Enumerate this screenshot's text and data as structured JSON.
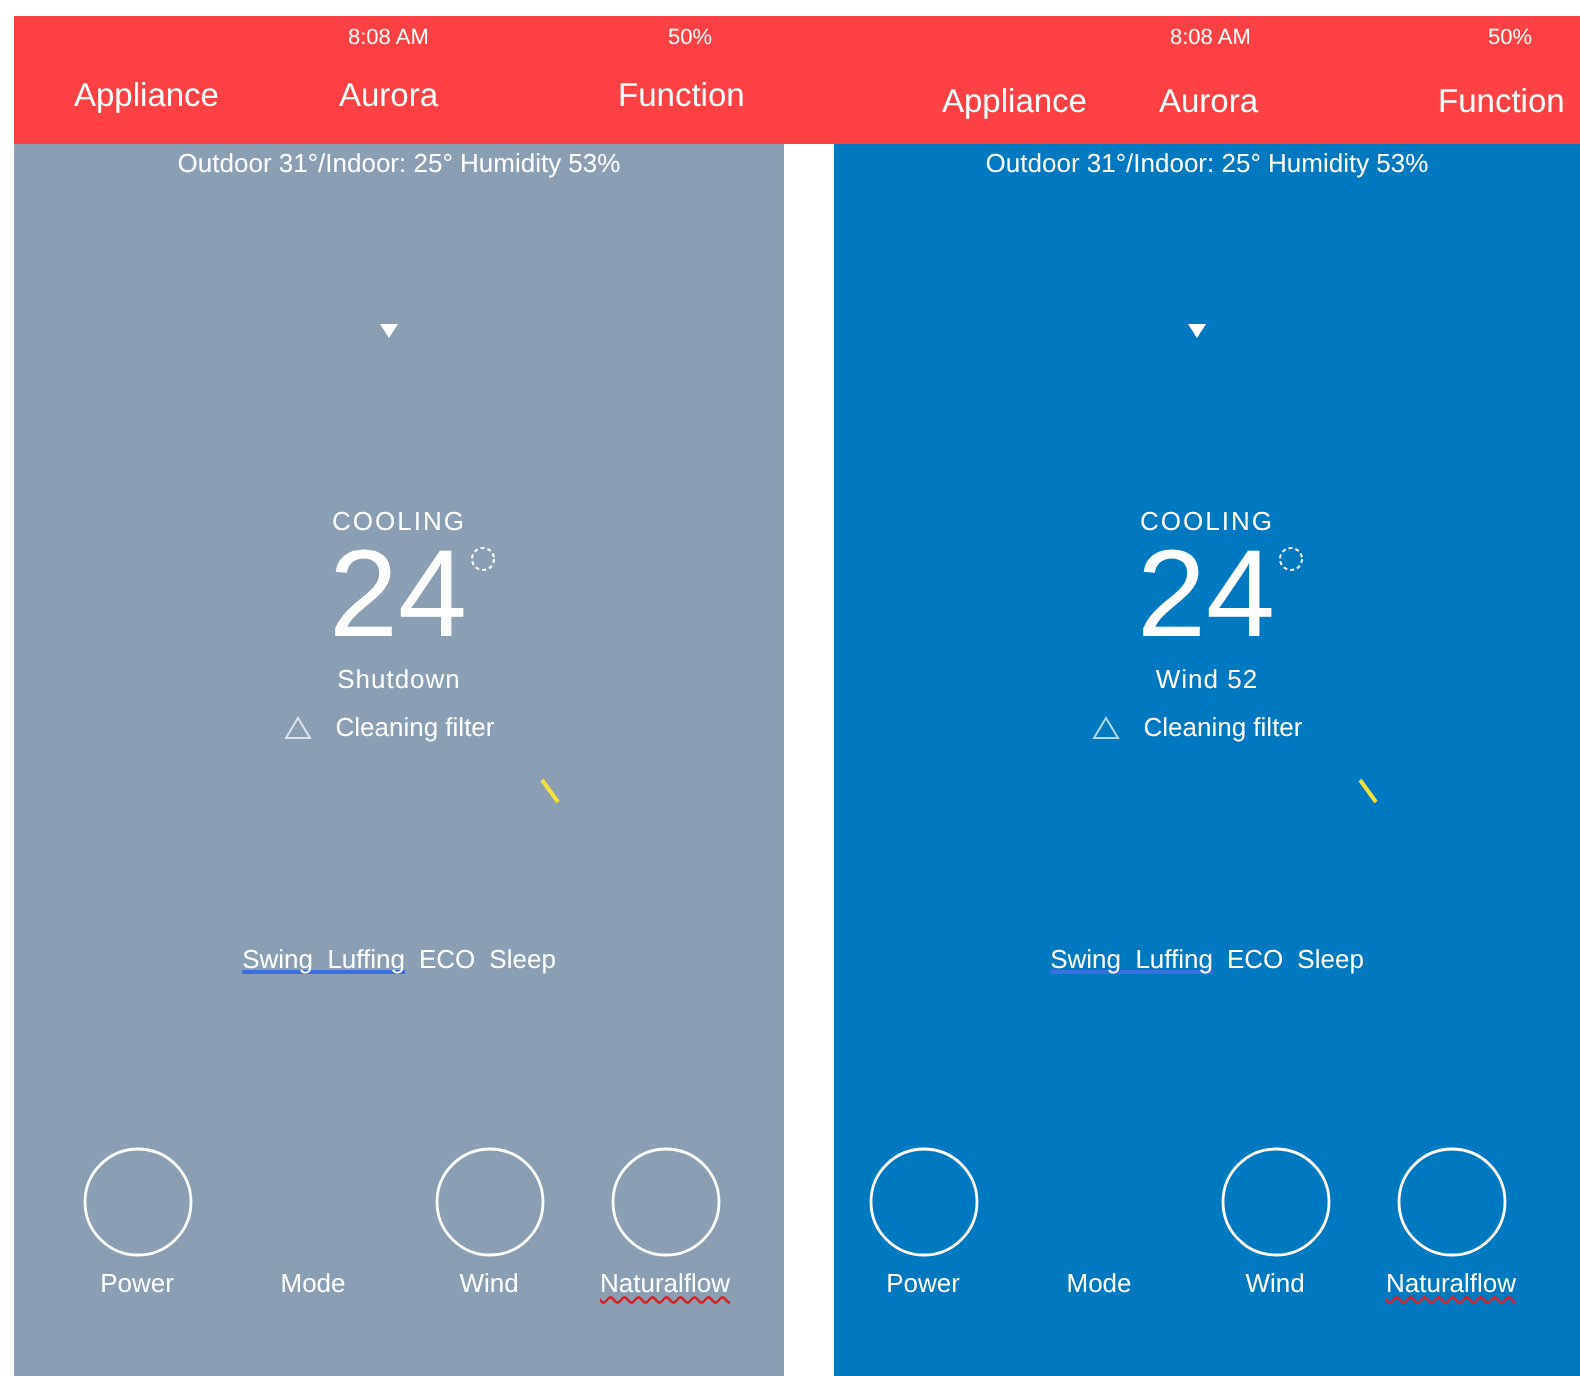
{
  "screens": [
    {
      "powered": false,
      "status_bar": {
        "time": "8:08  AM",
        "battery": "50%"
      },
      "nav": {
        "left": "Appliance",
        "title": "Aurora",
        "right": "Function"
      },
      "climate": "Outdoor 31°/Indoor: 25° Humidity 53%",
      "mode": "COOLING",
      "temperature": "24",
      "state": "Shutdown",
      "alert": "Cleaning filter",
      "options": [
        {
          "label": "Swing  Luffing",
          "underlined": true
        },
        {
          "label": "ECO",
          "underlined": false
        },
        {
          "label": "Sleep",
          "underlined": false
        }
      ],
      "controls": [
        {
          "kind": "dial",
          "label": "Power",
          "misspelled": false
        },
        {
          "kind": "plain",
          "label": "Mode",
          "misspelled": false
        },
        {
          "kind": "dial",
          "label": "Wind",
          "misspelled": false
        },
        {
          "kind": "dial",
          "label": "Naturalflow",
          "misspelled": true
        }
      ]
    },
    {
      "powered": true,
      "status_bar": {
        "time": "8:08  AM",
        "battery": "50%"
      },
      "nav": {
        "left": "Appliance",
        "title": "Aurora",
        "right": "Function"
      },
      "climate": "Outdoor 31°/Indoor: 25° Humidity 53%",
      "mode": "COOLING",
      "temperature": "24",
      "state": "Wind 52",
      "alert": "Cleaning filter",
      "options": [
        {
          "label": "Swing  Luffing",
          "underlined": true
        },
        {
          "label": "ECO",
          "underlined": false
        },
        {
          "label": "Sleep",
          "underlined": false
        }
      ],
      "controls": [
        {
          "kind": "dial",
          "label": "Power",
          "misspelled": false
        },
        {
          "kind": "plain",
          "label": "Mode",
          "misspelled": false
        },
        {
          "kind": "dial",
          "label": "Wind",
          "misspelled": false
        },
        {
          "kind": "dial",
          "label": "Naturalflow",
          "misspelled": true
        }
      ]
    }
  ]
}
